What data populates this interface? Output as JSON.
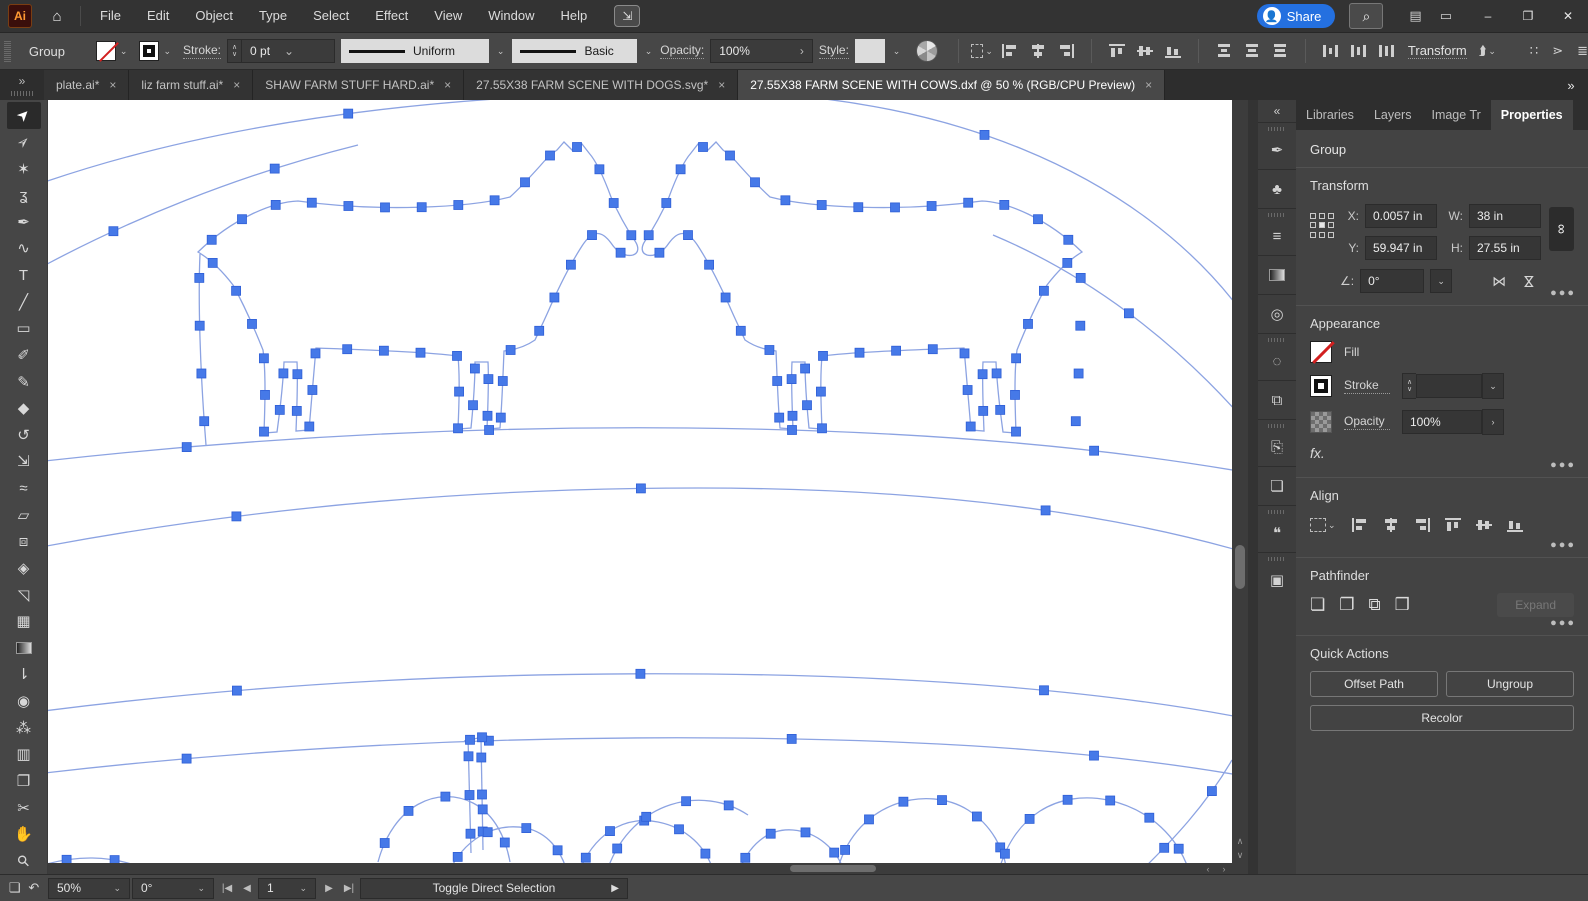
{
  "window": {
    "logo": "Ai",
    "menu": [
      "File",
      "Edit",
      "Object",
      "Type",
      "Select",
      "Effect",
      "View",
      "Window",
      "Help"
    ],
    "share_label": "Share",
    "minimize": "–",
    "restore": "❐",
    "close": "✕"
  },
  "control_bar": {
    "context_label": "Group",
    "stroke_label": "Stroke:",
    "stroke_value": "0 pt",
    "variable_width_value": "Uniform",
    "brush_value": "Basic",
    "opacity_label": "Opacity:",
    "opacity_value": "100%",
    "style_label": "Style:",
    "transform_label": "Transform"
  },
  "tab_bar": {
    "overflow_left": "»",
    "overflow_right": "»",
    "tabs": [
      {
        "label": "plate.ai*",
        "active": false
      },
      {
        "label": "liz farm stuff.ai*",
        "active": false
      },
      {
        "label": "SHAW FARM STUFF HARD.ai*",
        "active": false
      },
      {
        "label": "27.55X38 FARM SCENE WITH DOGS.svg*",
        "active": false
      },
      {
        "label": "27.55X38 FARM SCENE WITH COWS.dxf @ 50 % (RGB/CPU Preview)",
        "active": true
      }
    ]
  },
  "toolbar": {
    "tools": [
      {
        "name": "selection",
        "glyph": "➤",
        "rot": true,
        "active": true
      },
      {
        "name": "direct-selection",
        "glyph": "➢",
        "rot": true
      },
      {
        "name": "magic-wand",
        "glyph": "✶"
      },
      {
        "name": "lasso",
        "glyph": "ʓ"
      },
      {
        "name": "pen",
        "glyph": "✒"
      },
      {
        "name": "curvature",
        "glyph": "∿"
      },
      {
        "name": "type",
        "glyph": "T"
      },
      {
        "name": "line-segment",
        "glyph": "╱"
      },
      {
        "name": "rectangle",
        "glyph": "▭"
      },
      {
        "name": "paintbrush",
        "glyph": "✐"
      },
      {
        "name": "shaper",
        "glyph": "✎"
      },
      {
        "name": "eraser",
        "glyph": "◆"
      },
      {
        "name": "rotate",
        "glyph": "↺"
      },
      {
        "name": "scale",
        "glyph": "⇲"
      },
      {
        "name": "width",
        "glyph": "≈"
      },
      {
        "name": "free-transform",
        "glyph": "▱"
      },
      {
        "name": "shape-builder",
        "glyph": "⧈"
      },
      {
        "name": "live-paint",
        "glyph": "◈"
      },
      {
        "name": "perspective-grid",
        "glyph": "◹"
      },
      {
        "name": "mesh",
        "glyph": "▦"
      },
      {
        "name": "gradient",
        "glyph": "",
        "css": "gradient"
      },
      {
        "name": "eyedropper",
        "glyph": "⇂"
      },
      {
        "name": "blend",
        "glyph": "◉"
      },
      {
        "name": "symbol-sprayer",
        "glyph": "⁂"
      },
      {
        "name": "column-graph",
        "glyph": "▥"
      },
      {
        "name": "artboard",
        "glyph": "❐"
      },
      {
        "name": "slice",
        "glyph": "✂"
      },
      {
        "name": "hand",
        "glyph": "✋"
      },
      {
        "name": "zoom",
        "glyph": "⚲",
        "rot": true
      }
    ]
  },
  "panel_strip": {
    "collapse": "«",
    "icons": [
      {
        "name": "tools-drawer",
        "glyph": "✒"
      },
      {
        "name": "symbols",
        "glyph": "♣"
      },
      {
        "name": "stroke-panel",
        "glyph": "≡"
      },
      {
        "name": "gradient-panel",
        "glyph": "",
        "css": "gradient"
      },
      {
        "name": "transparency-panel",
        "glyph": "◎"
      },
      {
        "name": "selection-panel",
        "glyph": "◌"
      },
      {
        "name": "artboards-panel",
        "glyph": "⧉"
      },
      {
        "name": "export-panel",
        "glyph": "⎘"
      },
      {
        "name": "arrange-panel",
        "glyph": "❏"
      },
      {
        "name": "comments-panel",
        "glyph": "❝"
      },
      {
        "name": "pathfinder-panel",
        "glyph": "▣"
      }
    ]
  },
  "properties": {
    "tabs": [
      "Libraries",
      "Layers",
      "Image Tr",
      "Properties"
    ],
    "context_label": "Group",
    "transform": {
      "title": "Transform",
      "x_label": "X:",
      "x_value": "0.0057 in",
      "y_label": "Y:",
      "y_value": "59.947 in",
      "w_label": "W:",
      "w_value": "38 in",
      "h_label": "H:",
      "h_value": "27.55 in",
      "angle_value": "0°"
    },
    "appearance": {
      "title": "Appearance",
      "fill_label": "Fill",
      "stroke_label": "Stroke",
      "opacity_label": "Opacity",
      "opacity_value": "100%",
      "fx_label": "fx."
    },
    "align": {
      "title": "Align"
    },
    "pathfinder": {
      "title": "Pathfinder",
      "expand_label": "Expand"
    },
    "quick_actions": {
      "title": "Quick Actions",
      "buttons": [
        "Offset Path",
        "Ungroup",
        "Recolor"
      ]
    }
  },
  "status_bar": {
    "zoom": "50%",
    "rotation": "0°",
    "artboard": "1",
    "tool_hint": "Toggle Direct Selection"
  },
  "colors": {
    "accent_blue": "#2470e0",
    "path_blue": "#8ca3e2",
    "anchor_blue": "#4679e8"
  }
}
